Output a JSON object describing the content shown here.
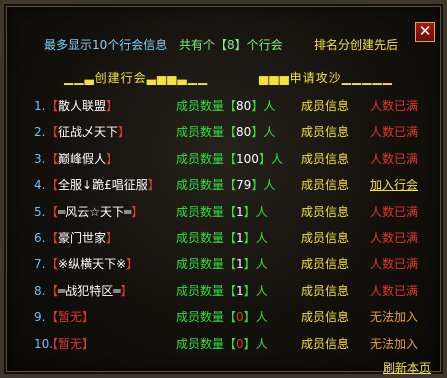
{
  "header": {
    "limit_text": "最多显示10个行会信息",
    "total_text": "共有个【8】个行会",
    "sort_text": "排名分创建先后",
    "close_label": "✕"
  },
  "sections": {
    "left": "▁▁▃创建行会▃▅▅▃▁▁",
    "right": "▅▅▅申请攻沙▁▁▁▁▁"
  },
  "guilds": [
    {
      "index": "1.",
      "name": "散人联盟",
      "name_color": "#ffffff",
      "count_label": "成员数量",
      "count": "80",
      "count_color": "#ffffff",
      "unit": "人",
      "info": "成员信息",
      "status": "人数已满",
      "status_type": "full"
    },
    {
      "index": "2.",
      "name": "征战乄天下",
      "name_color": "#ffffff",
      "count_label": "成员数量",
      "count": "80",
      "count_color": "#ffffff",
      "unit": "人",
      "info": "成员信息",
      "status": "人数已满",
      "status_type": "full"
    },
    {
      "index": "3.",
      "name": "巅峰假人",
      "name_color": "#ffffff",
      "count_label": "成员数量",
      "count": "100",
      "count_color": "#ffffff",
      "unit": "人",
      "info": "成员信息",
      "status": "人数已满",
      "status_type": "full"
    },
    {
      "index": "4.",
      "name": "全服↓跪£唱征服",
      "name_color": "#ffffff",
      "count_label": "成员数量",
      "count": "79",
      "count_color": "#ffffff",
      "unit": "人",
      "info": "成员信息",
      "status": "加入行会",
      "status_type": "join"
    },
    {
      "index": "5.",
      "name": "═风云☆天下═",
      "name_color": "#ffffff",
      "count_label": "成员数量",
      "count": "1",
      "count_color": "#ffffff",
      "unit": "人",
      "info": "成员信息",
      "status": "人数已满",
      "status_type": "full"
    },
    {
      "index": "6.",
      "name": "豪门世家",
      "name_color": "#ffffff",
      "count_label": "成员数量",
      "count": "1",
      "count_color": "#ffffff",
      "unit": "人",
      "info": "成员信息",
      "status": "人数已满",
      "status_type": "full"
    },
    {
      "index": "7.",
      "name": "※纵横天下※",
      "name_color": "#ffffff",
      "count_label": "成员数量",
      "count": "1",
      "count_color": "#ffffff",
      "unit": "人",
      "info": "成员信息",
      "status": "人数已满",
      "status_type": "full"
    },
    {
      "index": "8.",
      "name": "═战犯特区═",
      "name_color": "#ffffff",
      "count_label": "成员数量",
      "count": "1",
      "count_color": "#ffffff",
      "unit": "人",
      "info": "成员信息",
      "status": "人数已满",
      "status_type": "full"
    },
    {
      "index": "9.",
      "name": "暂无",
      "name_color": "#e0392a",
      "count_label": "成员数量",
      "count": "0",
      "count_color": "#e0392a",
      "unit": "人",
      "info": "成员信息",
      "status": "无法加入",
      "status_type": "cant"
    },
    {
      "index": "10.",
      "name": "暂无",
      "name_color": "#e0392a",
      "count_label": "成员数量",
      "count": "0",
      "count_color": "#e0392a",
      "unit": "人",
      "info": "成员信息",
      "status": "无法加入",
      "status_type": "cant"
    }
  ],
  "footer": {
    "refresh_label": "刷新本页"
  },
  "colors": {
    "accent_yellow": "#f6e23a",
    "label_green": "#35e03a",
    "alert_red": "#e0392a",
    "index_blue": "#6fbfff",
    "unavailable_orange": "#f0a020"
  }
}
